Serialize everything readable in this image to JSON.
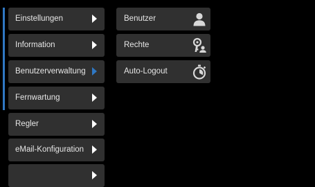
{
  "menu": {
    "items": [
      {
        "label": "Einstellungen",
        "active": false
      },
      {
        "label": "Information",
        "active": false
      },
      {
        "label": "Benutzerverwaltung",
        "active": true
      },
      {
        "label": "Fernwartung",
        "active": false
      },
      {
        "label": "Regler",
        "active": false
      },
      {
        "label": "eMail-Konfiguration",
        "active": false
      },
      {
        "label": "",
        "active": false
      }
    ]
  },
  "submenu": {
    "items": [
      {
        "label": "Benutzer",
        "icon": "user-icon"
      },
      {
        "label": "Rechte",
        "icon": "key-user-icon"
      },
      {
        "label": "Auto-Logout",
        "icon": "stopwatch-icon"
      }
    ]
  },
  "colors": {
    "background": "#000000",
    "button": "#303030",
    "accent": "#2f78c4",
    "text": "#e6e6e6",
    "icon": "#d8d8d8"
  }
}
